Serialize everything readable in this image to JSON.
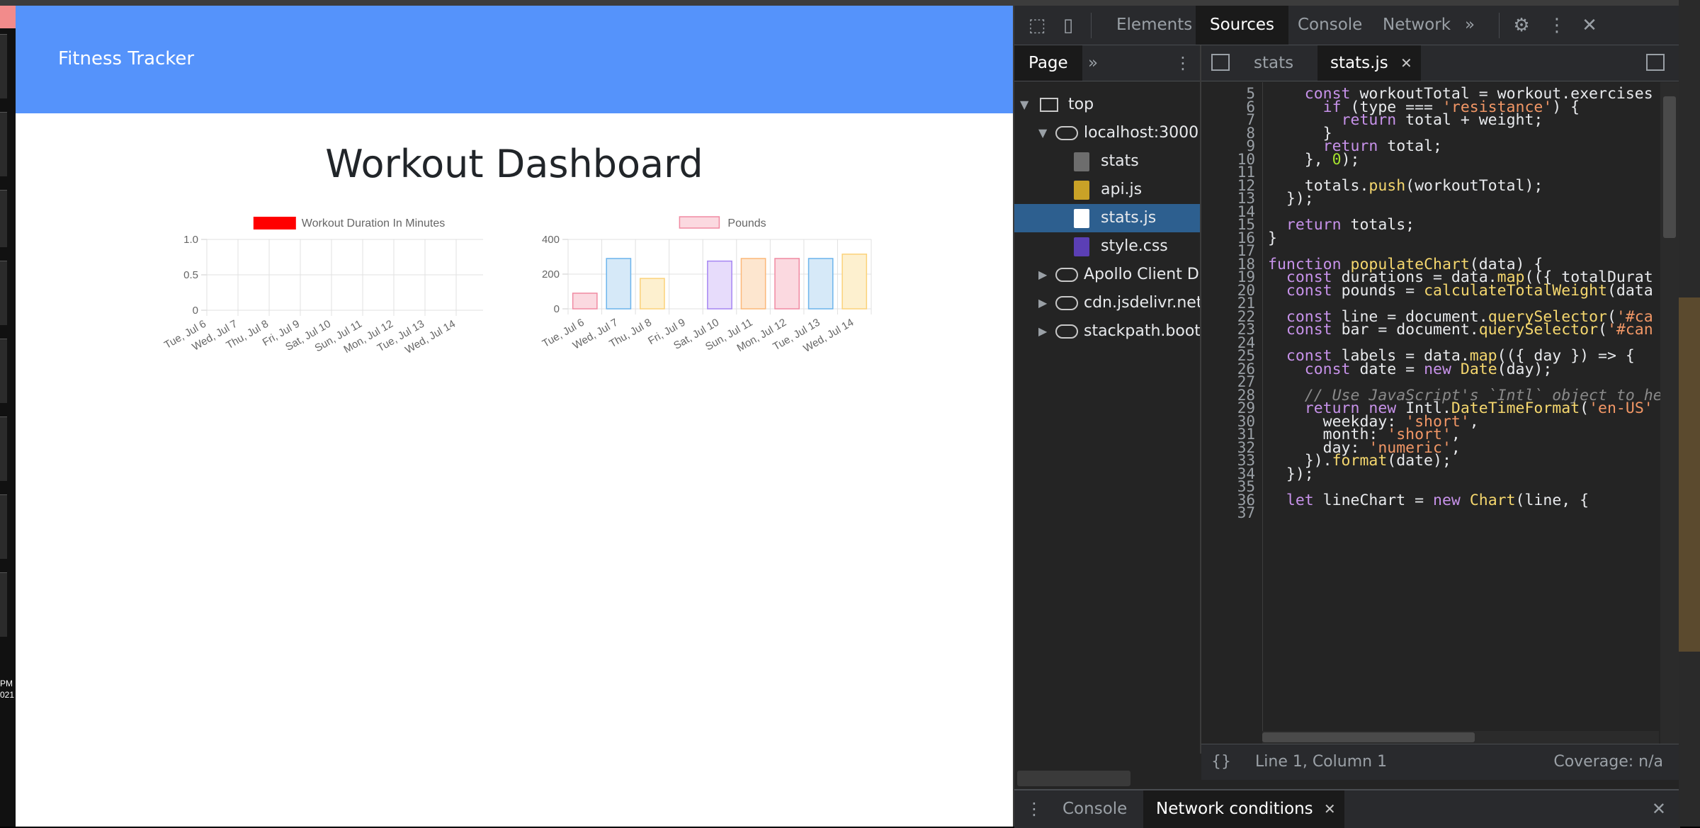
{
  "app": {
    "brand": "Fitness Tracker",
    "title": "Workout Dashboard"
  },
  "chart_data": [
    {
      "type": "line",
      "legend": [
        "Workout Duration In Minutes"
      ],
      "legend_color": "#ff0000",
      "categories": [
        "Tue, Jul 6",
        "Wed, Jul 7",
        "Thu, Jul 8",
        "Fri, Jul 9",
        "Sat, Jul 10",
        "Sun, Jul 11",
        "Mon, Jul 12",
        "Tue, Jul 13",
        "Wed, Jul 14"
      ],
      "yticks": [
        "1.0",
        "0.5",
        "0"
      ],
      "ylim": [
        0,
        1
      ],
      "series": [
        {
          "name": "Workout Duration In Minutes",
          "values": []
        }
      ],
      "grid": true
    },
    {
      "type": "bar",
      "legend": [
        "Pounds"
      ],
      "categories": [
        "Tue, Jul 6",
        "Wed, Jul 7",
        "Thu, Jul 8",
        "Fri, Jul 9",
        "Sat, Jul 10",
        "Sun, Jul 11",
        "Mon, Jul 12",
        "Tue, Jul 13",
        "Wed, Jul 14"
      ],
      "values": [
        90,
        290,
        175,
        0,
        275,
        290,
        290,
        290,
        315
      ],
      "yticks": [
        "400",
        "200",
        "0"
      ],
      "ylim": [
        0,
        400
      ],
      "grid": true,
      "bar_fills": [
        "#fbd9e0",
        "#d6e9f8",
        "#fdf0cf",
        "#e0f2f2",
        "#e7dcfb",
        "#fde6cf",
        "#fbd9e0",
        "#d6e9f8",
        "#fdf0cf"
      ],
      "bar_strokes": [
        "#f08aa2",
        "#6cb4ec",
        "#fbd27a",
        "#7fcccc",
        "#a585f2",
        "#fbb879",
        "#f08aa2",
        "#6cb4ec",
        "#fbd27a"
      ]
    }
  ],
  "devtools": {
    "tabs": [
      "Elements",
      "Sources",
      "Console",
      "Network"
    ],
    "active_tab": "Sources",
    "more": "»",
    "nav": {
      "page_tab": "Page",
      "more": "»",
      "tree": [
        "top",
        "localhost:3000",
        "stats",
        "api.js",
        "stats.js",
        "style.css",
        "Apollo Client D",
        "cdn.jsdelivr.net",
        "stackpath.boots"
      ]
    },
    "editor_tabs": [
      "stats",
      "stats.js"
    ],
    "code": {
      "first_line": 5,
      "lines": [
        "    const workoutTotal = workout.exercises",
        "      if (type === 'resistance') {",
        "        return total + weight;",
        "      }",
        "      return total;",
        "    }, 0);",
        "",
        "    totals.push(workoutTotal);",
        "  });",
        "",
        "  return totals;",
        "}",
        "",
        "function populateChart(data) {",
        "  const durations = data.map(({ totalDurat",
        "  const pounds = calculateTotalWeight(data",
        "",
        "  const line = document.querySelector('#ca",
        "  const bar = document.querySelector('#can",
        "",
        "  const labels = data.map(({ day }) => {",
        "    const date = new Date(day);",
        "",
        "    // Use JavaScript's `Intl` object to he",
        "    return new Intl.DateTimeFormat('en-US'",
        "      weekday: 'short',",
        "      month: 'short',",
        "      day: 'numeric',",
        "    }).format(date);",
        "  });",
        "",
        "  let lineChart = new Chart(line, {",
        ""
      ]
    },
    "status": {
      "position": "Line 1, Column 1",
      "coverage": "Coverage: n/a",
      "format_icon": "{}"
    },
    "drawer": {
      "tabs": [
        "Console",
        "Network conditions"
      ],
      "active": "Network conditions"
    }
  },
  "desktop": {
    "clock_line1": "PM",
    "clock_line2": "021"
  }
}
